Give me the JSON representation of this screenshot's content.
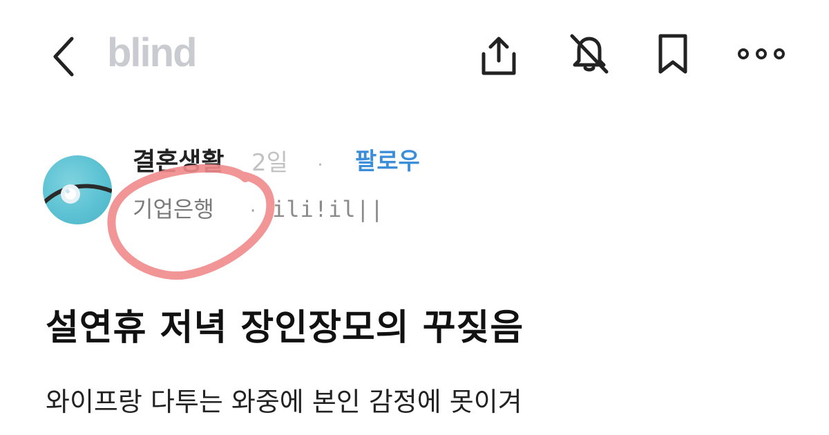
{
  "header": {
    "brand": "blind",
    "icons": [
      "back-chevron-icon",
      "share-icon",
      "notification-off-icon",
      "bookmark-icon",
      "more-icon"
    ]
  },
  "author": {
    "name": "결혼생활",
    "time": "2일",
    "separator": "·",
    "follow_label": "팔로우",
    "company": "기업은행",
    "grade": "ili!il||"
  },
  "post": {
    "title": "설연휴 저녁 장인장모의 꾸짖음",
    "body": "와이프랑 다투는 와중에 본인 감정에 못이겨"
  },
  "colors": {
    "accent": "#3d8ed9",
    "brand": "#c9cbd1",
    "annotation": "#f08a8c"
  }
}
